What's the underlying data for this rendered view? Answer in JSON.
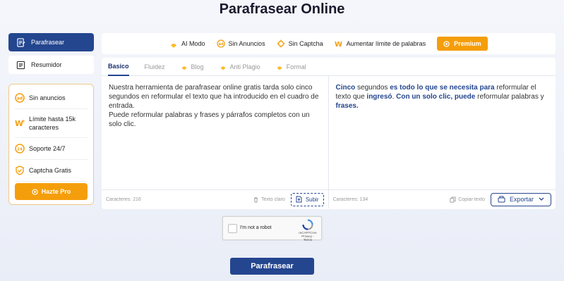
{
  "page": {
    "title": "Parafrasear Online"
  },
  "sidebar": {
    "items": [
      {
        "label": "Parafrasear",
        "icon": "paraphrase-icon",
        "active": true
      },
      {
        "label": "Resumidor",
        "icon": "summarize-icon",
        "active": false
      }
    ],
    "benefits": [
      {
        "label": "Sin anuncios",
        "icon": "no-ads-icon"
      },
      {
        "label": "Límite hasta 15k caracteres",
        "icon": "word-limit-icon"
      },
      {
        "label": "Soporte 24/7",
        "icon": "support-icon"
      },
      {
        "label": "Captcha Gratis",
        "icon": "captcha-icon"
      }
    ],
    "pro_button": "Hazte Pro"
  },
  "features": [
    {
      "label": "AI Modo",
      "icon": "ai-mode-icon"
    },
    {
      "label": "Sin Anuncios",
      "icon": "no-ads-icon"
    },
    {
      "label": "Sin Captcha",
      "icon": "no-captcha-icon"
    },
    {
      "label": "Aumentar límite de palabras",
      "icon": "word-limit-icon"
    }
  ],
  "premium_button": "Premium",
  "tabs": [
    {
      "label": "Basico",
      "active": true,
      "locked": false
    },
    {
      "label": "Fluidez",
      "active": false,
      "locked": false
    },
    {
      "label": "Blog",
      "active": false,
      "locked": true
    },
    {
      "label": "Anti Plagio",
      "active": false,
      "locked": true
    },
    {
      "label": "Formal",
      "active": false,
      "locked": true
    }
  ],
  "input": {
    "line1": "Nuestra herramienta de parafrasear online gratis tarda solo cinco segundos en reformular el texto que ha introducido en el cuadro de entrada.",
    "line2": "Puede reformular palabras y frases y párrafos completos con un solo clic.",
    "chars_label": "Caracteres: 216",
    "clear_label": "Texto claro",
    "upload_label": "Subir"
  },
  "output": {
    "segments": [
      {
        "text": " Cinco",
        "hl": true
      },
      {
        "text": " segundos ",
        "hl": false
      },
      {
        "text": "es todo lo que se necesita para",
        "hl": true
      },
      {
        "text": " reformular el texto que ",
        "hl": false
      },
      {
        "text": "ingresó",
        "hl": true
      },
      {
        "text": ".  ",
        "hl": false
      },
      {
        "text": "Con un solo clic, puede",
        "hl": true
      },
      {
        "text": " reformular palabras y ",
        "hl": false
      },
      {
        "text": "frases.",
        "hl": true
      }
    ],
    "chars_label": "Caracteres: 134",
    "copy_label": "Copiar texto",
    "export_label": "Exportar"
  },
  "captcha": {
    "label": "I'm not a robot",
    "brand": "reCAPTCHA",
    "links": "Privacy - Terms"
  },
  "submit_button": "Parafrasear",
  "colors": {
    "primary": "#24468f",
    "accent": "#f59e0b"
  }
}
